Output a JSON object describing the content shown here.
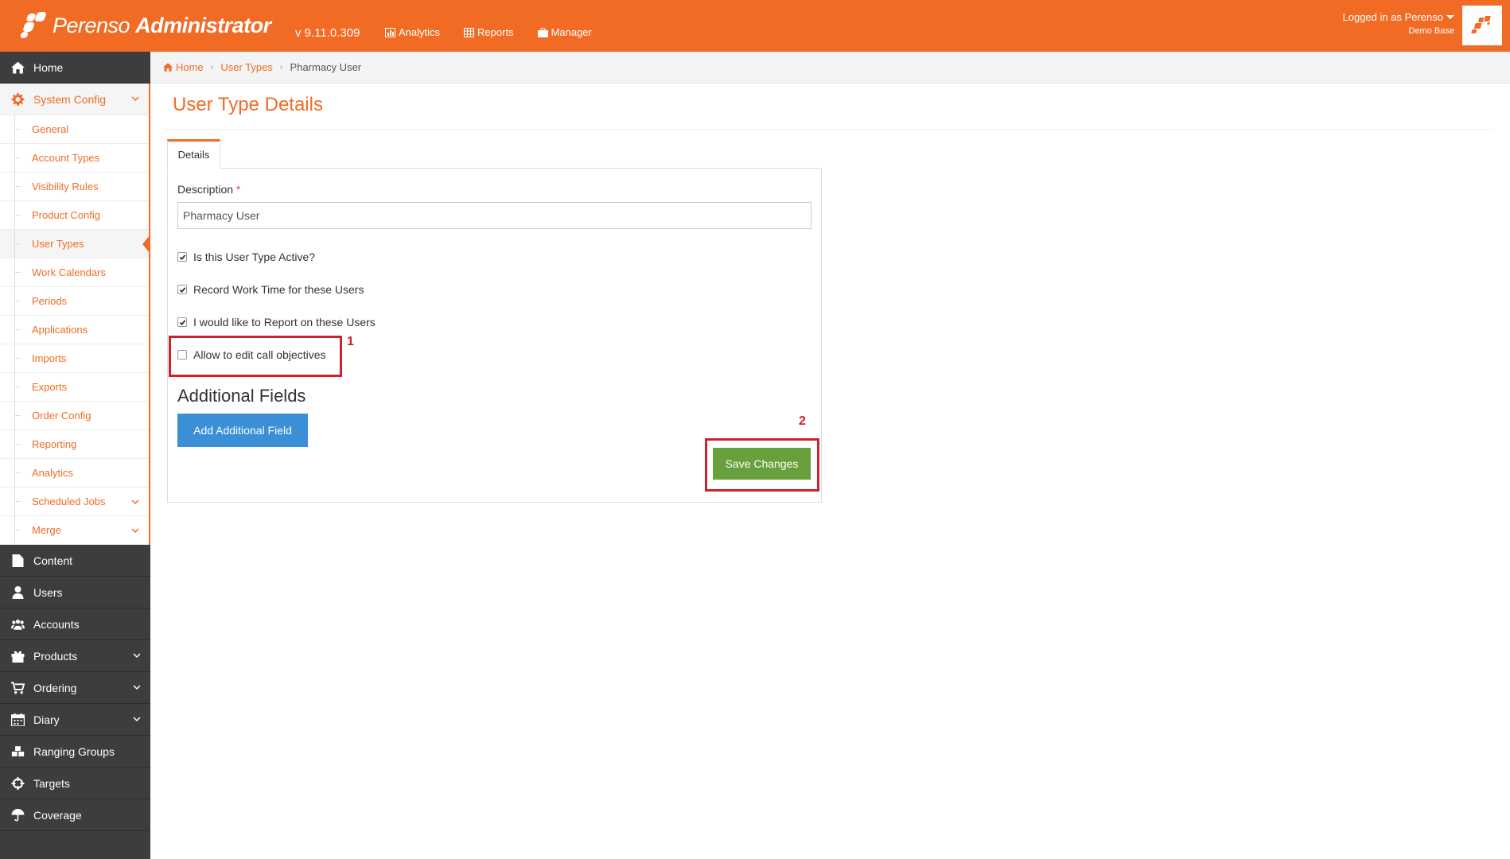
{
  "header": {
    "brand_light": "Perenso ",
    "brand_bold": "Administrator",
    "version": "v 9.11.0.309",
    "nav": [
      {
        "label": "Analytics",
        "icon": "chart-icon"
      },
      {
        "label": "Reports",
        "icon": "table-icon"
      },
      {
        "label": "Manager",
        "icon": "briefcase-icon"
      }
    ],
    "logged_in": "Logged in as Perenso",
    "base": "Demo Base"
  },
  "sidebar": {
    "home": "Home",
    "system_config": "System Config",
    "sub_items": [
      "General",
      "Account Types",
      "Visibility Rules",
      "Product Config",
      "User Types",
      "Work Calendars",
      "Periods",
      "Applications",
      "Imports",
      "Exports",
      "Order Config",
      "Reporting",
      "Analytics",
      "Scheduled Jobs",
      "Merge"
    ],
    "bottom_items": [
      "Content",
      "Users",
      "Accounts",
      "Products",
      "Ordering",
      "Diary",
      "Ranging Groups",
      "Targets",
      "Coverage"
    ]
  },
  "breadcrumb": {
    "home": "Home",
    "parent": "User Types",
    "current": "Pharmacy User"
  },
  "main": {
    "title": "User Type Details",
    "tab": "Details",
    "description_label": "Description",
    "required_mark": "*",
    "description_value": "Pharmacy User",
    "checkboxes": [
      {
        "label": "Is this User Type Active?",
        "checked": true
      },
      {
        "label": "Record Work Time for these Users",
        "checked": true
      },
      {
        "label": "I would like to Report on these Users",
        "checked": true
      },
      {
        "label": "Allow to edit call objectives",
        "checked": false
      }
    ],
    "additional_fields_title": "Additional Fields",
    "add_field_button": "Add Additional Field",
    "save_button": "Save Changes"
  },
  "annotations": {
    "first": "1",
    "second": "2"
  },
  "colors": {
    "brand": "#f26b25",
    "sidebar": "#3d3d3d",
    "primary_btn": "#3a8fd6",
    "save_btn": "#67a03c",
    "highlight": "#d0202b"
  }
}
